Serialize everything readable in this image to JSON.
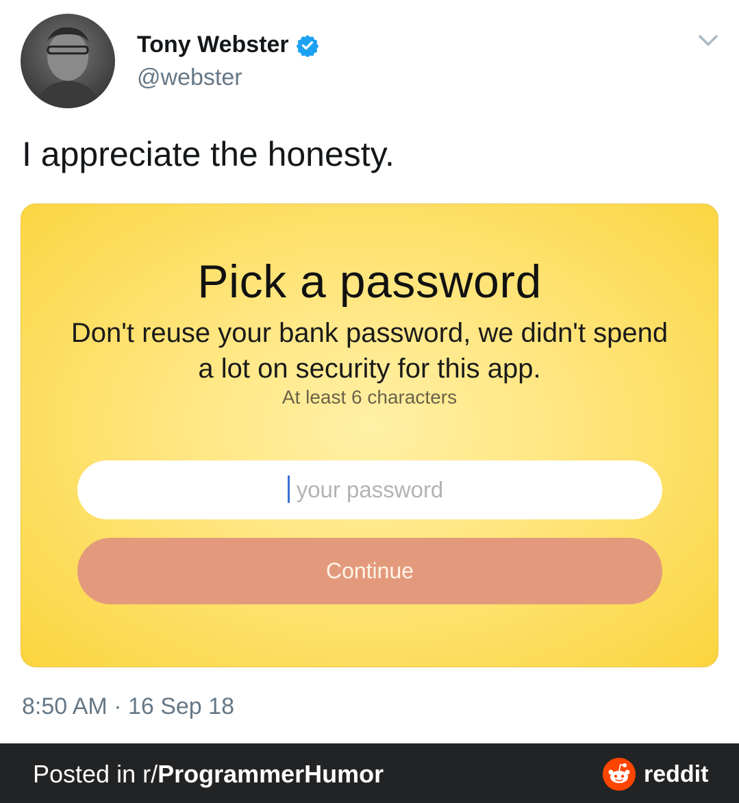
{
  "tweet": {
    "author_name": "Tony Webster",
    "handle": "@webster",
    "text": "I appreciate the honesty.",
    "timestamp": "8:50 AM · 16 Sep 18"
  },
  "card": {
    "title": "Pick a password",
    "subtitle": "Don't reuse your bank password, we didn't spend a lot on security for this app.",
    "hint": "At least 6 characters",
    "input_placeholder": "your password",
    "button_label": "Continue"
  },
  "footer": {
    "posted_prefix": "Posted in r/",
    "subreddit": "ProgrammerHumor",
    "brand": "reddit"
  },
  "colors": {
    "verified": "#1da1f2",
    "card_yellow": "#fbd43e",
    "button": "#e39a7c",
    "footer_bg": "#222324",
    "reddit_orange": "#ff4500"
  },
  "icons": [
    "verified-badge-icon",
    "chevron-down-icon",
    "reddit-logo-icon"
  ]
}
